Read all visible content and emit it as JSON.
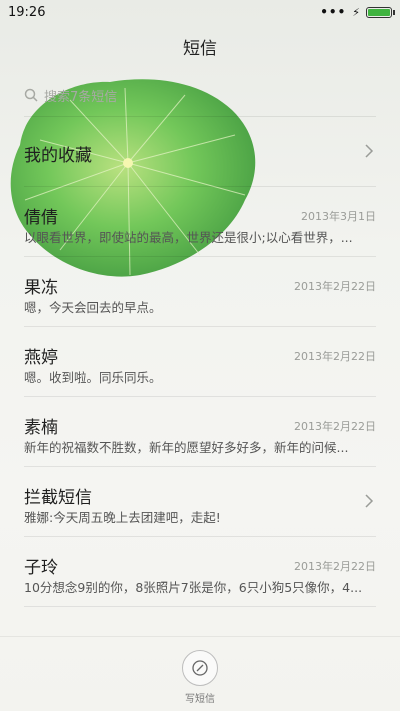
{
  "status": {
    "time": "19:26",
    "dots": "•••"
  },
  "header": {
    "title": "短信"
  },
  "search": {
    "placeholder": "搜索7条短信"
  },
  "favorites": {
    "label": "我的收藏"
  },
  "conversations": [
    {
      "name": "倩倩",
      "date": "2013年3月1日",
      "preview": "以眼看世界，即使站的最高，世界还是很小;以心看世界，..."
    },
    {
      "name": "果冻",
      "date": "2013年2月22日",
      "preview": "嗯，今天会回去的早点。"
    },
    {
      "name": "燕婷",
      "date": "2013年2月22日",
      "preview": "嗯。收到啦。同乐同乐。"
    },
    {
      "name": "素楠",
      "date": "2013年2月22日",
      "preview": "新年的祝福数不胜数，新年的愿望好多好多，新年的问候..."
    }
  ],
  "blocked": {
    "name": "拦截短信",
    "preview": "雅娜:今天周五晚上去团建吧，走起!"
  },
  "last": {
    "name": "子玲",
    "date": "2013年2月22日",
    "preview": "10分想念9别的你，8张照片7张是你，6只小狗5只像你，4..."
  },
  "compose": {
    "label": "写短信"
  },
  "colors": {
    "battery": "#3fb33f",
    "leaf": "#5fc14e"
  }
}
